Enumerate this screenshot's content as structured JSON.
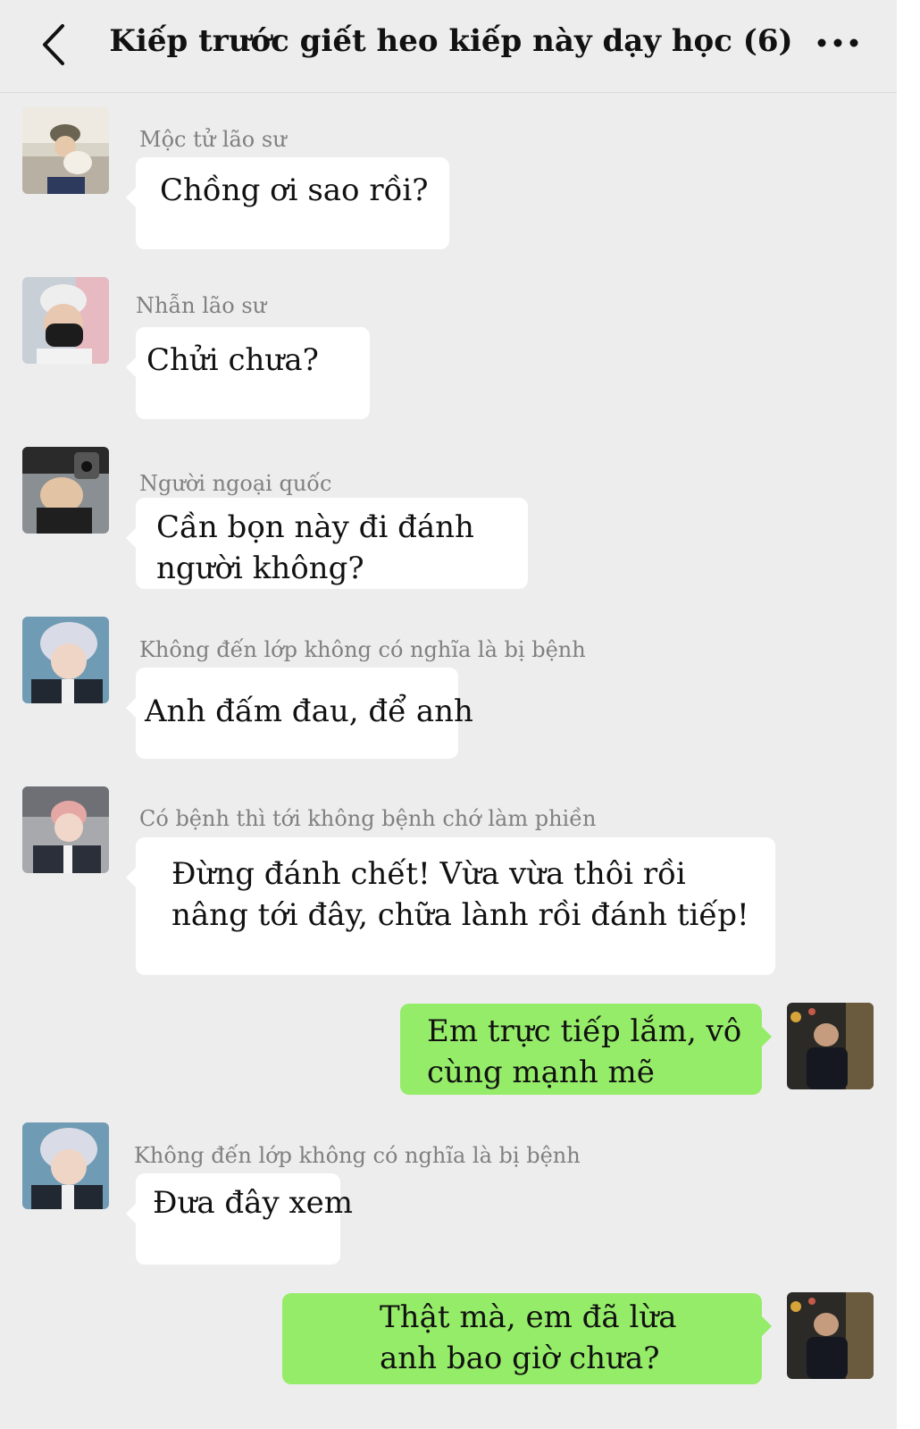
{
  "header": {
    "title": "Kiếp trước giết heo kiếp này dạy học (6)",
    "back_icon": "chevron-left-icon",
    "more_icon": "more-dots-icon"
  },
  "colors": {
    "background": "#ededed",
    "incoming_bubble": "#ffffff",
    "outgoing_bubble": "#95ec69",
    "sender_name": "#808080"
  },
  "messages": [
    {
      "sender": "Mộc tử lão sư",
      "direction": "incoming",
      "lines": [
        "Chồng ơi sao rồi?"
      ]
    },
    {
      "sender": "Nhẫn lão sư",
      "direction": "incoming",
      "lines": [
        "Chửi chưa?"
      ]
    },
    {
      "sender": "Người ngoại quốc",
      "direction": "incoming",
      "lines": [
        "Cần bọn này đi đánh",
        "người không?"
      ]
    },
    {
      "sender": "Không đến lớp không có nghĩa là bị bệnh",
      "direction": "incoming",
      "lines": [
        "Anh đấm đau, để anh"
      ]
    },
    {
      "sender": "Có bệnh thì tới không bệnh chớ làm phiền",
      "direction": "incoming",
      "lines": [
        "Đừng đánh chết! Vừa vừa thôi rồi",
        "nâng tới đây, chữa lành rồi đánh tiếp!"
      ]
    },
    {
      "sender": "",
      "direction": "outgoing",
      "lines": [
        "Em trực tiếp lắm, vô",
        "cùng mạnh mẽ"
      ]
    },
    {
      "sender": "Không đến lớp không có nghĩa là bị bệnh",
      "direction": "incoming",
      "lines": [
        "Đưa đây xem"
      ]
    },
    {
      "sender": "",
      "direction": "outgoing",
      "lines": [
        "Thật mà, em đã lừa",
        "anh bao giờ chưa?"
      ]
    }
  ]
}
